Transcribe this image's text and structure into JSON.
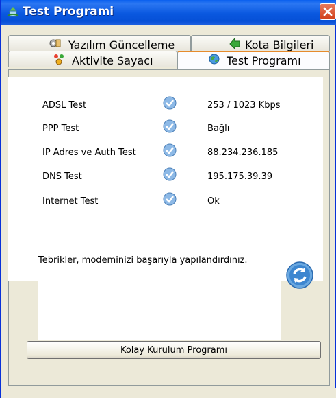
{
  "window": {
    "title": "Test Programi"
  },
  "tabs": {
    "software_update": "Yazılım Güncelleme",
    "quota_info": "Kota Bilgileri",
    "activity_counter": "Aktivite Sayacı",
    "test_program": "Test Programı"
  },
  "tests": [
    {
      "label": "ADSL Test",
      "value": "253 / 1023 Kbps",
      "status": "passed"
    },
    {
      "label": "PPP Test",
      "value": "Bağlı",
      "status": "passed"
    },
    {
      "label": "IP Adres ve Auth Test",
      "value": "88.234.236.185",
      "status": "passed"
    },
    {
      "label": "DNS Test",
      "value": "195.175.39.39",
      "status": "passed"
    },
    {
      "label": "Internet Test",
      "value": "Ok",
      "status": "passed"
    }
  ],
  "message": "Tebrikler, modeminizi başarıyla yapılandırdınız.",
  "buttons": {
    "setup": "Kolay Kurulum Programı"
  },
  "icons": {
    "title": "app-icon",
    "close": "close-icon",
    "check": "check-icon",
    "refresh": "refresh-icon"
  },
  "colors": {
    "titlebar": "#0a58e0",
    "close": "#d1401a",
    "check": "#4a8fd6",
    "tab_active_border": "#e68b2c"
  }
}
